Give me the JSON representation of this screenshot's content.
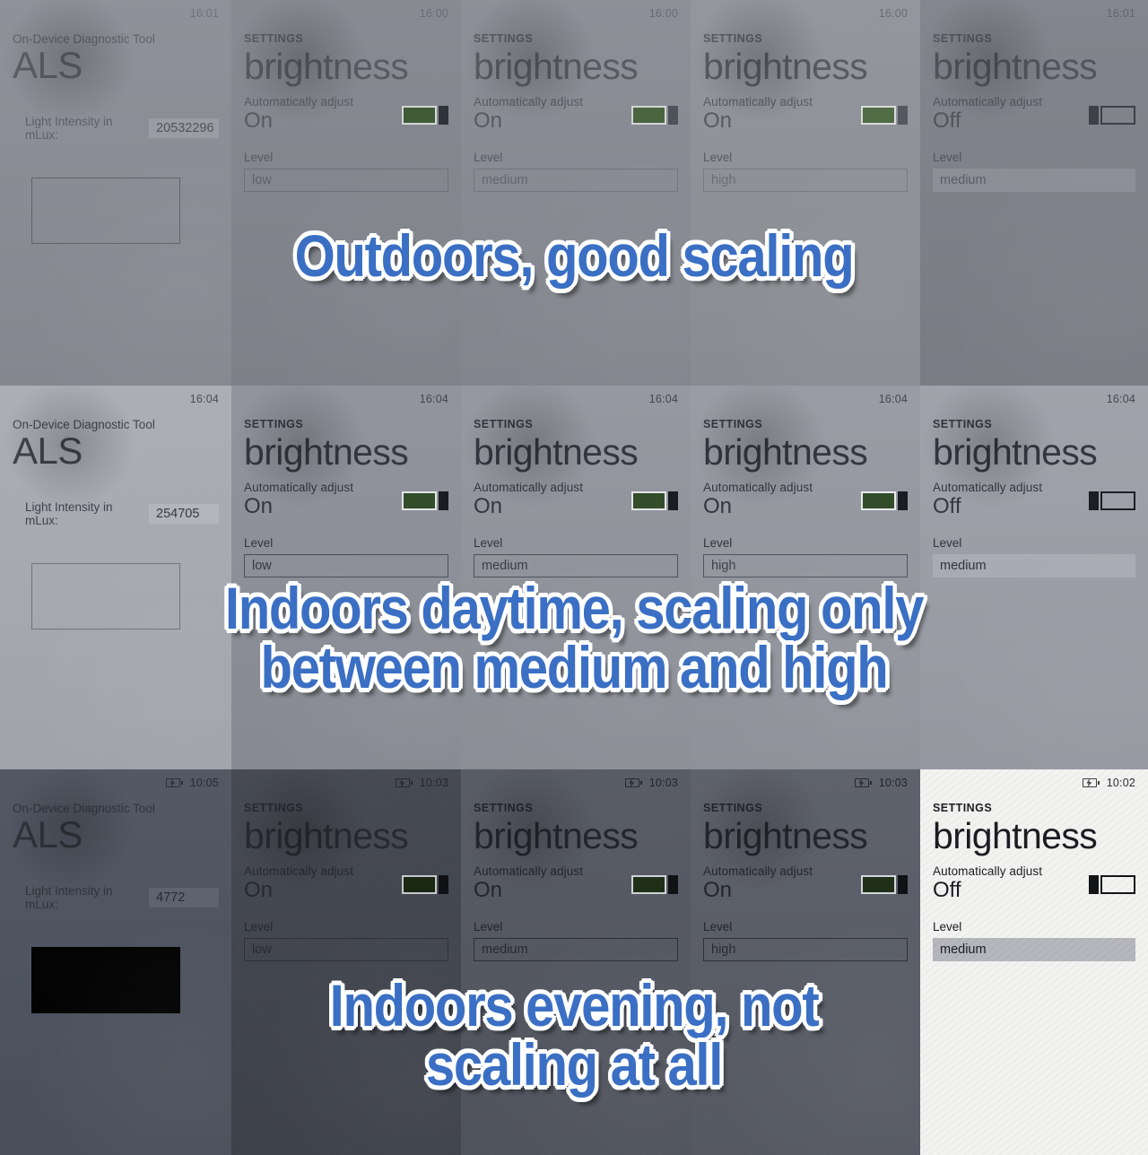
{
  "captions": [
    {
      "text": "Outdoors, good scaling"
    },
    {
      "text": "Indoors daytime, scaling only\nbetween medium and high"
    },
    {
      "text": "Indoors evening, not\nscaling at all"
    }
  ],
  "colors": {
    "caption_text": "#3a6fc4",
    "caption_outline": "#ffffff",
    "toggle_on_fill": "#3c5a33",
    "toggle_off_thumb": "#1b1f25"
  },
  "rows": [
    {
      "name": "outdoors",
      "als": {
        "time": "16:01",
        "battery_icon": "",
        "app_label": "On-Device Diagnostic Tool",
        "app_title": "ALS",
        "intensity_label": "Light Intensity in mLux:",
        "intensity_value": "20532296",
        "rect_style": "outline"
      },
      "settings": [
        {
          "time": "16:00",
          "battery_icon": "",
          "eyebrow": "SETTINGS",
          "title": "brightness",
          "auto_label": "Automatically adjust",
          "auto_value": "On",
          "toggle": "on",
          "level_label": "Level",
          "level_value": "low",
          "level_style": "outline"
        },
        {
          "time": "16:00",
          "battery_icon": "",
          "eyebrow": "SETTINGS",
          "title": "brightness",
          "auto_label": "Automatically adjust",
          "auto_value": "On",
          "toggle": "on",
          "level_label": "Level",
          "level_value": "medium",
          "level_style": "outline"
        },
        {
          "time": "16:00",
          "battery_icon": "",
          "eyebrow": "SETTINGS",
          "title": "brightness",
          "auto_label": "Automatically adjust",
          "auto_value": "On",
          "toggle": "on",
          "level_label": "Level",
          "level_value": "high",
          "level_style": "outline"
        },
        {
          "time": "16:01",
          "battery_icon": "",
          "eyebrow": "SETTINGS",
          "title": "brightness",
          "auto_label": "Automatically adjust",
          "auto_value": "Off",
          "toggle": "off",
          "level_label": "Level",
          "level_value": "medium",
          "level_style": "filled"
        }
      ]
    },
    {
      "name": "indoors-daytime",
      "als": {
        "time": "16:04",
        "battery_icon": "",
        "app_label": "On-Device Diagnostic Tool",
        "app_title": "ALS",
        "intensity_label": "Light Intensity in mLux:",
        "intensity_value": "254705",
        "rect_style": "outline"
      },
      "settings": [
        {
          "time": "16:04",
          "battery_icon": "",
          "eyebrow": "SETTINGS",
          "title": "brightness",
          "auto_label": "Automatically adjust",
          "auto_value": "On",
          "toggle": "on",
          "level_label": "Level",
          "level_value": "low",
          "level_style": "outline"
        },
        {
          "time": "16:04",
          "battery_icon": "",
          "eyebrow": "SETTINGS",
          "title": "brightness",
          "auto_label": "Automatically adjust",
          "auto_value": "On",
          "toggle": "on",
          "level_label": "Level",
          "level_value": "medium",
          "level_style": "outline"
        },
        {
          "time": "16:04",
          "battery_icon": "",
          "eyebrow": "SETTINGS",
          "title": "brightness",
          "auto_label": "Automatically adjust",
          "auto_value": "On",
          "toggle": "on",
          "level_label": "Level",
          "level_value": "high",
          "level_style": "outline"
        },
        {
          "time": "16:04",
          "battery_icon": "",
          "eyebrow": "SETTINGS",
          "title": "brightness",
          "auto_label": "Automatically adjust",
          "auto_value": "Off",
          "toggle": "off",
          "level_label": "Level",
          "level_value": "medium",
          "level_style": "filled"
        }
      ]
    },
    {
      "name": "indoors-evening",
      "als": {
        "time": "10:05",
        "battery_icon": "battery-charging-icon",
        "app_label": "On-Device Diagnostic Tool",
        "app_title": "ALS",
        "intensity_label": "Light Intensity in mLux:",
        "intensity_value": "4772",
        "rect_style": "filled"
      },
      "settings": [
        {
          "time": "10:03",
          "battery_icon": "battery-charging-icon",
          "eyebrow": "SETTINGS",
          "title": "brightness",
          "auto_label": "Automatically adjust",
          "auto_value": "On",
          "toggle": "on",
          "level_label": "Level",
          "level_value": "low",
          "level_style": "outline"
        },
        {
          "time": "10:03",
          "battery_icon": "battery-charging-icon",
          "eyebrow": "SETTINGS",
          "title": "brightness",
          "auto_label": "Automatically adjust",
          "auto_value": "On",
          "toggle": "on",
          "level_label": "Level",
          "level_value": "medium",
          "level_style": "outline"
        },
        {
          "time": "10:03",
          "battery_icon": "battery-charging-icon",
          "eyebrow": "SETTINGS",
          "title": "brightness",
          "auto_label": "Automatically adjust",
          "auto_value": "On",
          "toggle": "on",
          "level_label": "Level",
          "level_value": "high",
          "level_style": "outline"
        },
        {
          "time": "10:02",
          "battery_icon": "battery-charging-icon",
          "eyebrow": "SETTINGS",
          "title": "brightness",
          "auto_label": "Automatically adjust",
          "auto_value": "Off",
          "toggle": "off",
          "level_label": "Level",
          "level_value": "medium",
          "level_style": "filled"
        }
      ]
    }
  ]
}
